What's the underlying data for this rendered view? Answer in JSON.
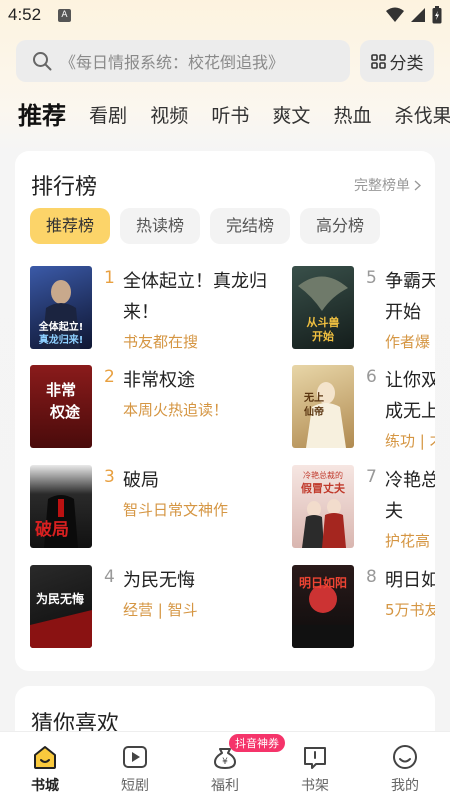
{
  "status_bar": {
    "time": "4:52",
    "app_indicator": "A"
  },
  "search": {
    "placeholder": "《每日情报系统：校花倒追我》",
    "category_label": "分类"
  },
  "top_tabs": [
    "推荐",
    "看剧",
    "视频",
    "听书",
    "爽文",
    "热血",
    "杀伐果断"
  ],
  "ranking": {
    "title": "排行榜",
    "more_label": "完整榜单",
    "sub_tabs": [
      "推荐榜",
      "热读榜",
      "完结榜",
      "高分榜"
    ],
    "books": [
      {
        "rank": "1",
        "title": "全体起立！真龙归\n来！",
        "subtitle": "书友都在搜",
        "cover_text": "全体起立!真龙归来!",
        "cover_color": "#1f2f5e"
      },
      {
        "rank": "2",
        "title": "非常权途",
        "subtitle": "本周火热追读！",
        "cover_text": "非常权途",
        "cover_color": "#6e1414"
      },
      {
        "rank": "3",
        "title": "破局",
        "subtitle": "智斗日常文神作",
        "cover_text": "破局",
        "cover_color": "#1c1c1c"
      },
      {
        "rank": "4",
        "title": "为民无悔",
        "subtitle": "经营 | 智斗",
        "cover_text": "为民无悔",
        "cover_color": "#151515"
      },
      {
        "rank": "5",
        "title": "争霸天\n开始",
        "subtitle": "作者爆",
        "cover_text": "从斗兽开始",
        "cover_color": "#23302c"
      },
      {
        "rank": "6",
        "title": "让你双\n成无上",
        "subtitle": "练功 | 才",
        "cover_text": "无上仙帝",
        "cover_color": "#c9a766"
      },
      {
        "rank": "7",
        "title": "冷艳总\n夫",
        "subtitle": "护花高",
        "cover_text": "冷艳总裁的假冒丈夫",
        "cover_color": "#e9d2cf"
      },
      {
        "rank": "8",
        "title": "明日如",
        "subtitle": "5万书友",
        "cover_text": "明日如阳",
        "cover_color": "#1a1a1a"
      }
    ]
  },
  "guess": {
    "title": "猜你喜欢"
  },
  "bottom_nav": {
    "items": [
      {
        "label": "书城",
        "icon": "bookstore-icon",
        "active": true
      },
      {
        "label": "短剧",
        "icon": "play-icon"
      },
      {
        "label": "福利",
        "icon": "welfare-icon",
        "badge": "抖音神券"
      },
      {
        "label": "书架",
        "icon": "bookshelf-icon"
      },
      {
        "label": "我的",
        "icon": "profile-icon"
      }
    ]
  },
  "colors": {
    "accent": "#fcd469",
    "rank_top": "#e8a040",
    "subtitle": "#d59643",
    "badge": "#f5346a"
  }
}
